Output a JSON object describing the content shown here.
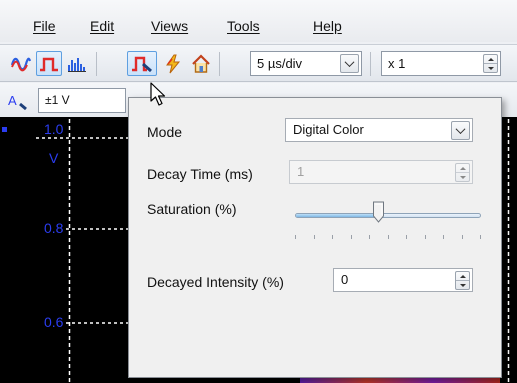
{
  "menu": {
    "items": [
      {
        "label": "File"
      },
      {
        "label": "Edit"
      },
      {
        "label": "Views"
      },
      {
        "label": "Tools"
      },
      {
        "label": "Help"
      }
    ]
  },
  "toolbar": {
    "timebase_value": "5 µs/div",
    "multiplier_value": "x 1",
    "channel_range": "±1 V",
    "active_mode_button": "persistence-mode"
  },
  "scope": {
    "y_labels": [
      "1.0",
      "V",
      "0.8",
      "0.6"
    ],
    "background": "#000000",
    "label_color": "#2b3df0"
  },
  "popup": {
    "mode_label": "Mode",
    "mode_value": "Digital Color",
    "decay_label": "Decay Time (ms)",
    "decay_value": "1",
    "saturation_label": "Saturation (%)",
    "saturation_level": 0.45,
    "decayed_label": "Decayed Intensity (%)",
    "decayed_value": "0"
  },
  "colors": {
    "accent": "#5e9fe0",
    "popup_bg": "#f0f0f0"
  }
}
